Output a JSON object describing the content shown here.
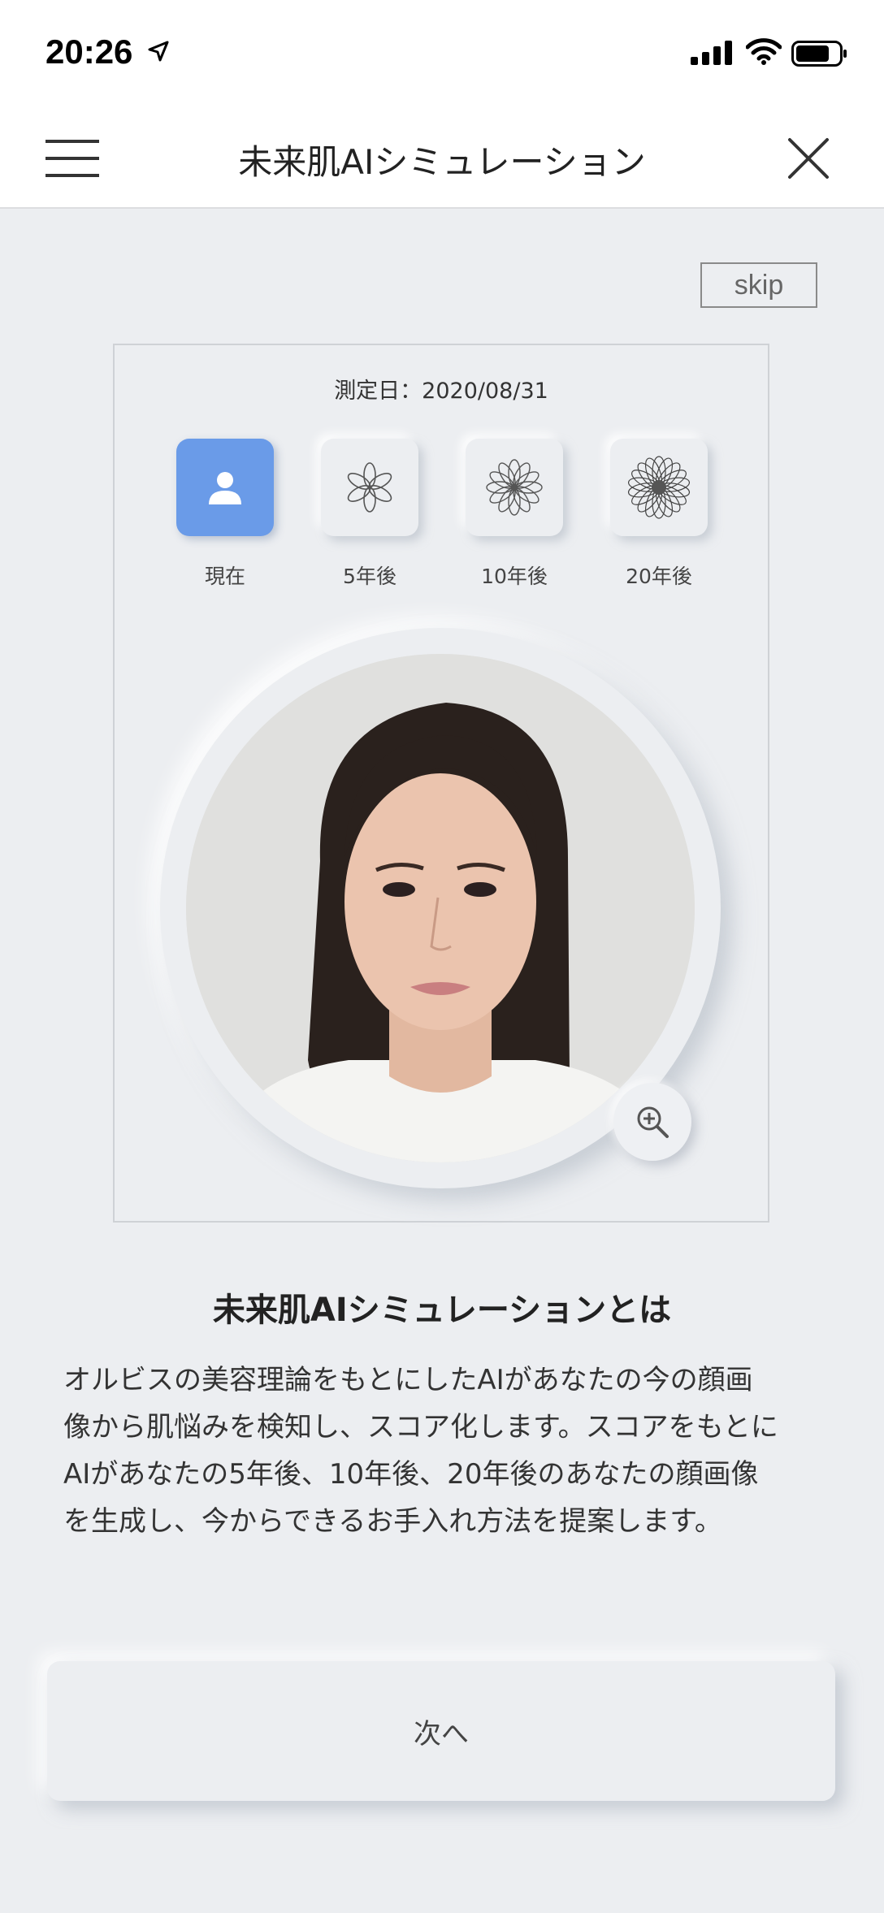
{
  "status_bar": {
    "time": "20:26"
  },
  "nav": {
    "title": "未来肌AIシミュレーション"
  },
  "skip_label": "skip",
  "panel": {
    "measure_date": "測定日：2020/08/31",
    "tabs": [
      {
        "label": "現在",
        "icon": "person-icon",
        "active": true
      },
      {
        "label": "5年後",
        "icon": "flower-small-icon",
        "active": false
      },
      {
        "label": "10年後",
        "icon": "flower-medium-icon",
        "active": false
      },
      {
        "label": "20年後",
        "icon": "flower-large-icon",
        "active": false
      }
    ]
  },
  "about": {
    "title": "未来肌AIシミュレーションとは",
    "lines": [
      "オルビスの美容理論をもとにしたAIがあなたの今の顔画",
      "像から肌悩みを検知し、スコア化します。スコアをもとに",
      "AIがあなたの5年後、10年後、20年後のあなたの顔画像",
      "を生成し、今からできるお手入れ方法を提案します。"
    ]
  },
  "next_label": "次へ",
  "colors": {
    "background": "#eceef1",
    "accent": "#6a9be8"
  }
}
